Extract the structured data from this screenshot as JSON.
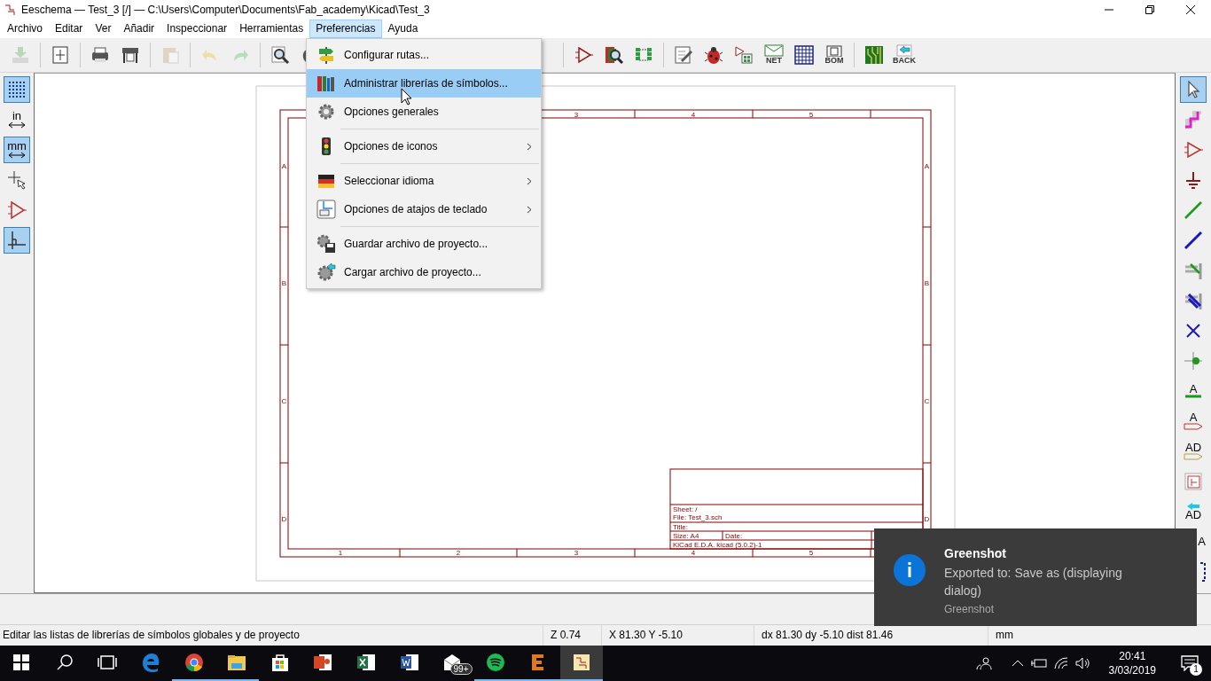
{
  "window": {
    "title": "Eeschema — Test_3 [/] — C:\\Users\\Computer\\Documents\\Fab_academy\\Kicad\\Test_3"
  },
  "menu": [
    {
      "label": "Archivo",
      "selected": false
    },
    {
      "label": "Editar",
      "selected": false
    },
    {
      "label": "Ver",
      "selected": false
    },
    {
      "label": "Añadir",
      "selected": false
    },
    {
      "label": "Inspeccionar",
      "selected": false
    },
    {
      "label": "Herramientas",
      "selected": false
    },
    {
      "label": "Preferencias",
      "selected": true
    },
    {
      "label": "Ayuda",
      "selected": false
    }
  ],
  "toolbar": {
    "left": [
      {
        "kind": "save",
        "disabled": true
      },
      {
        "kind": "separator"
      },
      {
        "kind": "page-settings",
        "disabled": false
      },
      {
        "kind": "separator"
      },
      {
        "kind": "print",
        "disabled": false
      },
      {
        "kind": "plot",
        "disabled": false
      },
      {
        "kind": "separator"
      },
      {
        "kind": "paste",
        "disabled": true
      },
      {
        "kind": "separator"
      },
      {
        "kind": "undo",
        "disabled": true
      },
      {
        "kind": "redo",
        "disabled": true
      },
      {
        "kind": "separator"
      },
      {
        "kind": "zoom",
        "disabled": false
      },
      {
        "kind": "refresh",
        "disabled": false
      }
    ],
    "right": [
      {
        "kind": "separator"
      },
      {
        "kind": "symbol-editor",
        "disabled": false
      },
      {
        "kind": "library-browser",
        "disabled": false
      },
      {
        "kind": "footprint-editor",
        "disabled": false
      },
      {
        "kind": "separator"
      },
      {
        "kind": "annotate",
        "disabled": false
      },
      {
        "kind": "erc",
        "disabled": false
      },
      {
        "kind": "assign-footprints",
        "disabled": false
      },
      {
        "kind": "netlist",
        "label": "NET",
        "disabled": false
      },
      {
        "kind": "bom-table",
        "disabled": false
      },
      {
        "kind": "bom",
        "label": "BOM",
        "disabled": false
      },
      {
        "kind": "separator"
      },
      {
        "kind": "pcb",
        "disabled": false
      },
      {
        "kind": "back",
        "label": "BACK",
        "disabled": false
      }
    ]
  },
  "left_toolbar": [
    {
      "kind": "grid",
      "selected": true
    },
    {
      "kind": "units",
      "label": "in",
      "selected": false
    },
    {
      "kind": "units",
      "label": "mm",
      "selected": true
    },
    {
      "kind": "cursor",
      "selected": false
    },
    {
      "kind": "hidden-pins",
      "selected": false
    },
    {
      "kind": "axes",
      "selected": true
    }
  ],
  "right_toolbar": [
    {
      "kind": "select",
      "selected": true
    },
    {
      "kind": "highlight",
      "selected": false
    },
    {
      "kind": "symbol",
      "selected": false
    },
    {
      "kind": "power",
      "selected": false
    },
    {
      "kind": "wire",
      "selected": false
    },
    {
      "kind": "bus",
      "selected": false
    },
    {
      "kind": "wire-entry",
      "selected": false
    },
    {
      "kind": "bus-entry",
      "selected": false
    },
    {
      "kind": "no-connect",
      "selected": false
    },
    {
      "kind": "junction",
      "selected": false
    },
    {
      "kind": "label",
      "label": "A",
      "selected": false
    },
    {
      "kind": "global-label",
      "label": "A",
      "selected": false
    },
    {
      "kind": "hier-label",
      "label": "AD",
      "selected": false
    },
    {
      "kind": "sheet",
      "selected": false
    },
    {
      "kind": "sheet-pin",
      "label": "AD",
      "selected": false
    },
    {
      "kind": "text",
      "label": "A",
      "selected": false
    },
    {
      "kind": "dashed",
      "selected": false
    }
  ],
  "preferences_menu": [
    {
      "kind": "item",
      "label": "Configurar rutas...",
      "submenu": false,
      "selected": false
    },
    {
      "kind": "item",
      "label": "Administrar librerías de símbolos...",
      "submenu": false,
      "selected": true
    },
    {
      "kind": "item",
      "label": "Opciones generales",
      "submenu": false,
      "selected": false
    },
    {
      "kind": "separator"
    },
    {
      "kind": "item",
      "label": "Opciones de iconos",
      "submenu": true,
      "selected": false
    },
    {
      "kind": "separator"
    },
    {
      "kind": "item",
      "label": "Seleccionar idioma",
      "submenu": true,
      "selected": false
    },
    {
      "kind": "item",
      "label": "Opciones de atajos de teclado",
      "submenu": true,
      "selected": false
    },
    {
      "kind": "separator"
    },
    {
      "kind": "item",
      "label": "Guardar archivo de proyecto...",
      "submenu": false,
      "selected": false
    },
    {
      "kind": "item",
      "label": "Cargar archivo de proyecto...",
      "submenu": false,
      "selected": false
    }
  ],
  "sheet": {
    "top_column_labels": [
      "3",
      "4",
      "5"
    ],
    "bottom_column_labels": [
      "1",
      "2",
      "3",
      "4",
      "5"
    ],
    "left_row_labels": [
      "A",
      "B",
      "C",
      "D"
    ],
    "right_row_labels": [
      "A",
      "B",
      "C",
      "D"
    ],
    "title_block": {
      "sheet": "Sheet: /",
      "file": "File: Test_3.sch",
      "title": "Title:",
      "size": "Size: A4",
      "date": "Date:",
      "kicad": "KiCad E.D.A.  kicad (5.0.2)-1"
    }
  },
  "status_bar": {
    "message": "Editar las listas de librerías de símbolos globales y de proyecto",
    "zoom": "Z 0.74",
    "position": "X 81.30  Y -5.10",
    "delta": "dx 81.30  dy -5.10  dist 81.46",
    "units": "mm"
  },
  "notification": {
    "title": "Greenshot",
    "body": "Exported to: Save as (displaying dialog)",
    "source": "Greenshot"
  },
  "taskbar": {
    "apps": [
      {
        "kind": "start",
        "running": false,
        "selected": false
      },
      {
        "kind": "search",
        "running": false,
        "selected": false
      },
      {
        "kind": "task-view",
        "running": false,
        "selected": false
      },
      {
        "kind": "edge",
        "running": false,
        "selected": false
      },
      {
        "kind": "chrome",
        "running": true,
        "selected": false
      },
      {
        "kind": "explorer",
        "running": true,
        "selected": false
      },
      {
        "kind": "store",
        "running": false,
        "selected": false
      },
      {
        "kind": "powerpoint",
        "running": false,
        "selected": false
      },
      {
        "kind": "excel",
        "running": false,
        "selected": false
      },
      {
        "kind": "word",
        "running": false,
        "selected": false
      },
      {
        "kind": "mail",
        "badge": "99+",
        "running": false,
        "selected": false
      },
      {
        "kind": "spotify",
        "running": true,
        "selected": false
      },
      {
        "kind": "e-app",
        "running": true,
        "selected": false
      },
      {
        "kind": "kicad",
        "running": true,
        "selected": true
      }
    ],
    "time": "20:41",
    "date": "3/03/2019",
    "notification_count": "1"
  }
}
